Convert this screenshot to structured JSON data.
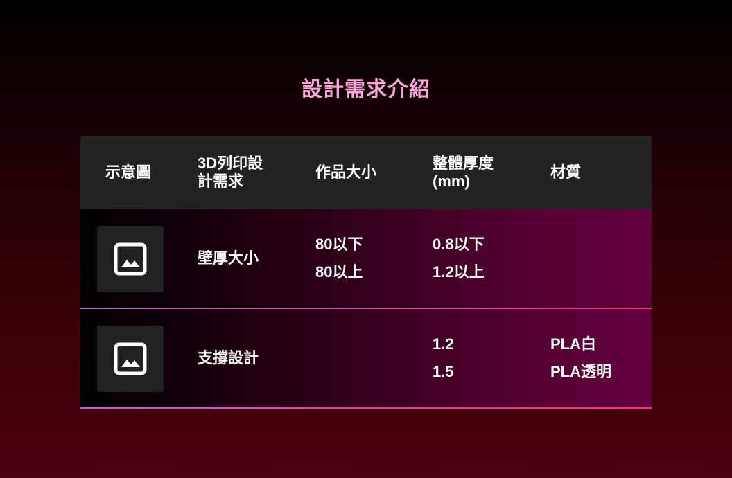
{
  "title": "設計需求介紹",
  "table": {
    "headers": [
      "示意圖",
      "3D列印設計需求",
      "作品大小",
      "整體厚度(mm)",
      "材質"
    ],
    "header_lines": {
      "col0": [
        "示意圖"
      ],
      "col1": [
        "3D列印設",
        "計需求"
      ],
      "col2": [
        "作品大小"
      ],
      "col3": [
        "整體厚度",
        "(mm)"
      ],
      "col4": [
        "材質"
      ]
    },
    "rows": [
      {
        "thumbnail_icon": "image-placeholder-icon",
        "requirement": "壁厚大小",
        "size": [
          "80以下",
          "80以上"
        ],
        "thickness": [
          "0.8以下",
          "1.2以上"
        ],
        "material": []
      },
      {
        "thumbnail_icon": "image-placeholder-icon",
        "requirement": "支撐設計",
        "size": [],
        "thickness": [
          "1.2",
          "1.5"
        ],
        "material": [
          "PLA白",
          "PLA透明"
        ]
      }
    ]
  },
  "colors": {
    "title": "#f6a6d9",
    "header_bg": "#222222",
    "row_gradient_end": "#620040",
    "divider": "#ff3070"
  }
}
